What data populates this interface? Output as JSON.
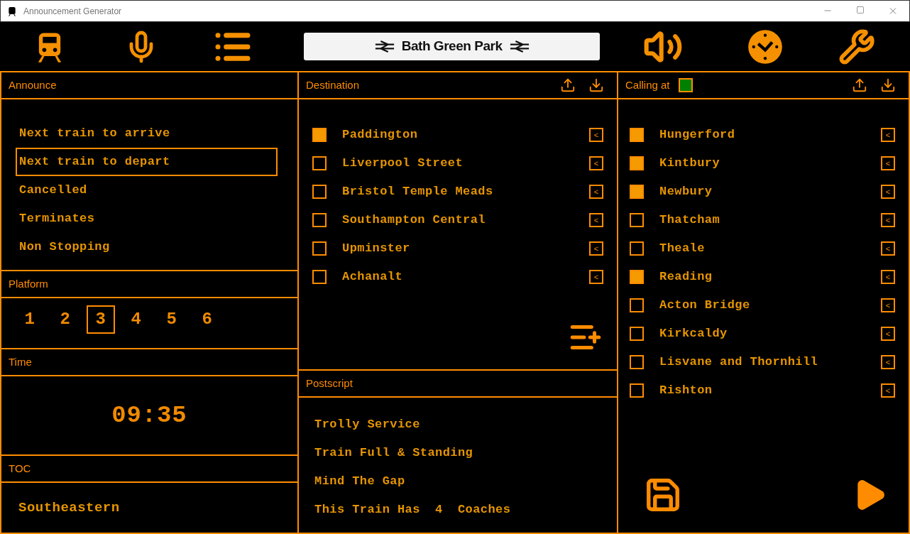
{
  "window": {
    "title": "Announcement Generator"
  },
  "station": {
    "name": "Bath Green Park"
  },
  "announce": {
    "title": "Announce",
    "items": [
      {
        "label": "Next train to arrive",
        "selected": false
      },
      {
        "label": "Next train to depart",
        "selected": true
      },
      {
        "label": "Cancelled",
        "selected": false
      },
      {
        "label": "Terminates",
        "selected": false
      },
      {
        "label": "Non Stopping",
        "selected": false
      }
    ]
  },
  "platform": {
    "title": "Platform",
    "items": [
      {
        "label": "1",
        "selected": false
      },
      {
        "label": "2",
        "selected": false
      },
      {
        "label": "3",
        "selected": true
      },
      {
        "label": "4",
        "selected": false
      },
      {
        "label": "5",
        "selected": false
      },
      {
        "label": "6",
        "selected": false
      }
    ]
  },
  "time": {
    "title": "Time",
    "value": "09:35"
  },
  "toc": {
    "title": "TOC",
    "value": "Southeastern"
  },
  "destination": {
    "title": "Destination",
    "items": [
      {
        "label": "Paddington",
        "checked": true,
        "button": "<"
      },
      {
        "label": "Liverpool Street",
        "checked": false,
        "button": "<"
      },
      {
        "label": "Bristol Temple Meads",
        "checked": false,
        "button": "<"
      },
      {
        "label": "Southampton Central",
        "checked": false,
        "button": "<"
      },
      {
        "label": "Upminster",
        "checked": false,
        "button": "<"
      },
      {
        "label": "Achanalt",
        "checked": false,
        "button": "<"
      }
    ]
  },
  "postscript": {
    "title": "Postscript",
    "items": [
      "Trolly Service",
      "Train Full & Standing",
      "Mind The Gap",
      "This Train Has  4  Coaches"
    ]
  },
  "calling_at": {
    "title": "Calling at",
    "indicator_on": true,
    "items": [
      {
        "label": "Hungerford",
        "checked": true,
        "button": "<"
      },
      {
        "label": "Kintbury",
        "checked": true,
        "button": "<"
      },
      {
        "label": "Newbury",
        "checked": true,
        "button": "<"
      },
      {
        "label": "Thatcham",
        "checked": false,
        "button": "<"
      },
      {
        "label": "Theale",
        "checked": false,
        "button": "<"
      },
      {
        "label": "Reading",
        "checked": true,
        "button": "<"
      },
      {
        "label": "Acton Bridge",
        "checked": false,
        "button": "<"
      },
      {
        "label": "Kirkcaldy",
        "checked": false,
        "button": "<"
      },
      {
        "label": "Lisvane and Thornhill",
        "checked": false,
        "button": "<"
      },
      {
        "label": "Rishton",
        "checked": false,
        "button": "<"
      }
    ]
  }
}
